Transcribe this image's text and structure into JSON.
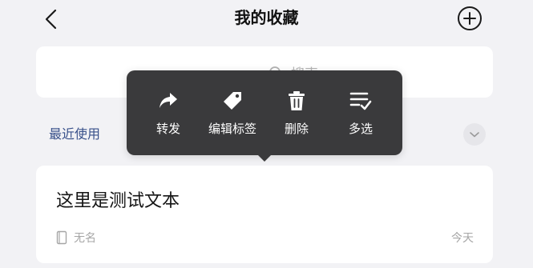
{
  "header": {
    "title": "我的收藏"
  },
  "search": {
    "placeholder": "搜索"
  },
  "context_menu": {
    "items": [
      {
        "label": "转发",
        "icon": "forward-icon"
      },
      {
        "label": "编辑标签",
        "icon": "tag-icon"
      },
      {
        "label": "删除",
        "icon": "trash-icon"
      },
      {
        "label": "多选",
        "icon": "multi-select-icon"
      }
    ]
  },
  "recent": {
    "label": "最近使用"
  },
  "item": {
    "text": "这里是测试文本",
    "source": "无名",
    "date": "今天"
  },
  "colors": {
    "background": "#f2f2f5",
    "menu_bg": "#3a3a3c",
    "section_label": "#38508a"
  }
}
